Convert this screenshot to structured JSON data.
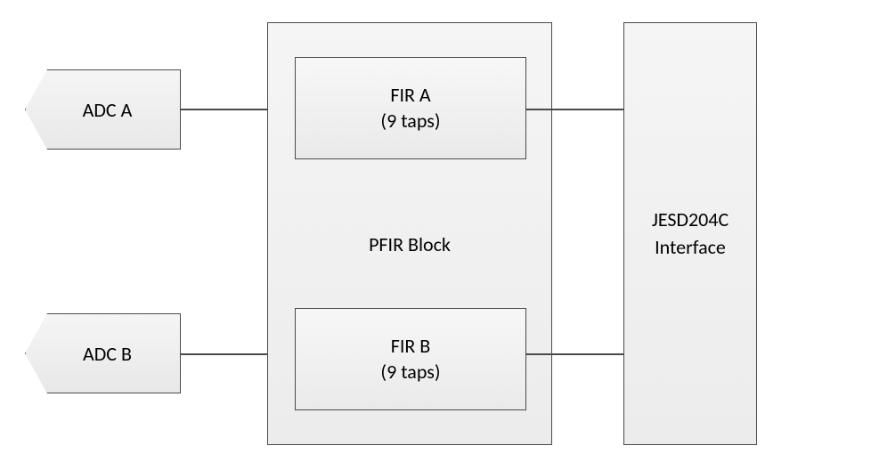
{
  "adc_a": {
    "label": "ADC A"
  },
  "adc_b": {
    "label": "ADC B"
  },
  "pfir": {
    "label": "PFIR Block",
    "fir_a": {
      "name": "FIR A",
      "taps": "(9 taps)"
    },
    "fir_b": {
      "name": "FIR B",
      "taps": "(9 taps)"
    }
  },
  "jesd": {
    "line1": "JESD204C",
    "line2": "Interface"
  }
}
